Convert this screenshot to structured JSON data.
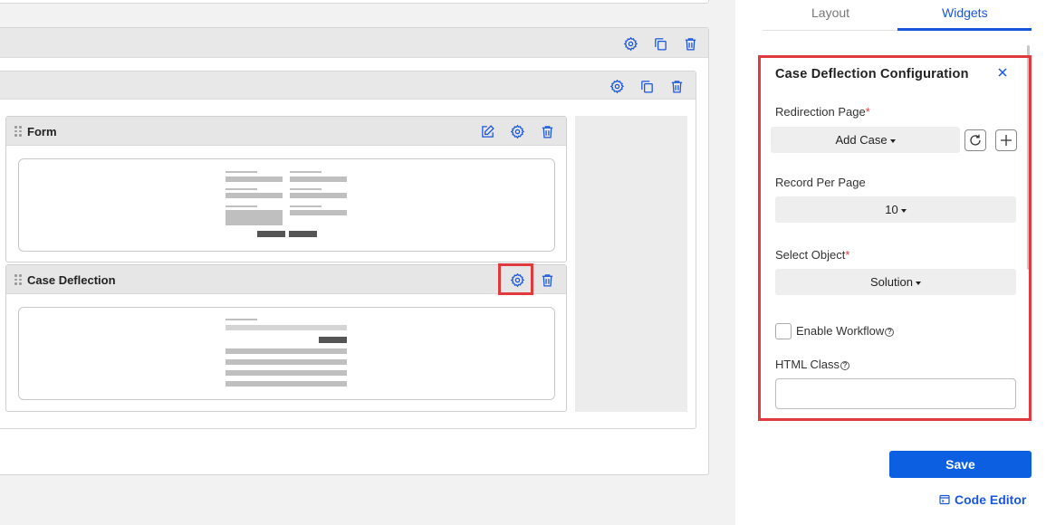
{
  "colors": {
    "accent": "#1a56db",
    "primary_button": "#0b5fe0",
    "highlight": "#e0393e",
    "required": "#e0393e"
  },
  "canvas": {
    "outer_section": {
      "icons": [
        "gear-icon",
        "copy-icon",
        "trash-icon"
      ]
    },
    "inner_section": {
      "icons": [
        "gear-icon",
        "copy-icon",
        "trash-icon"
      ]
    },
    "widgets": [
      {
        "title": "Form",
        "icons": [
          "edit-icon",
          "gear-icon",
          "trash-icon"
        ]
      },
      {
        "title": "Case Deflection",
        "icons": [
          "gear-icon",
          "trash-icon"
        ]
      }
    ]
  },
  "panel": {
    "tabs": [
      {
        "label": "Layout",
        "active": false
      },
      {
        "label": "Widgets",
        "active": true
      }
    ],
    "config": {
      "title": "Case Deflection Configuration",
      "required_mark": "*",
      "redirection_page": {
        "label": "Redirection Page",
        "value": "Add Case"
      },
      "record_per_page": {
        "label": "Record Per Page",
        "value": "10"
      },
      "select_object": {
        "label": "Select Object",
        "value": "Solution"
      },
      "enable_workflow": {
        "label": "Enable Workflow",
        "checked": false
      },
      "html_class": {
        "label": "HTML Class",
        "value": ""
      },
      "help_glyph": "?"
    },
    "save_label": "Save",
    "code_editor_label": "Code Editor"
  }
}
